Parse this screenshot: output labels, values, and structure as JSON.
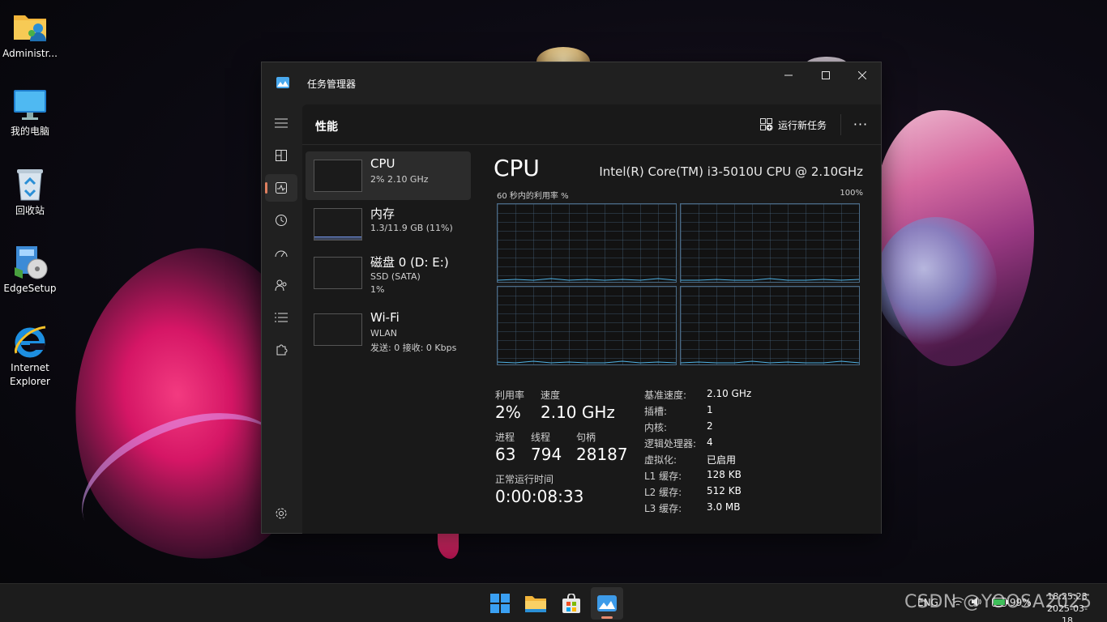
{
  "desktop": {
    "icons": [
      {
        "label": "Administr...",
        "icon": "user-folder-icon"
      },
      {
        "label": "我的电脑",
        "icon": "monitor-icon"
      },
      {
        "label": "回收站",
        "icon": "recycle-bin-icon"
      },
      {
        "label": "EdgeSetup",
        "icon": "installer-icon"
      },
      {
        "label": "Internet\nExplorer",
        "icon": "internet-explorer-icon"
      }
    ]
  },
  "window": {
    "title": "任务管理器"
  },
  "nav": {
    "icons": [
      "hamburger-icon",
      "processes-icon",
      "performance-icon",
      "app-history-icon",
      "startup-icon",
      "users-icon",
      "details-icon",
      "services-icon",
      "settings-icon"
    ],
    "active": "performance"
  },
  "header": {
    "title": "性能",
    "run_task": "运行新任务",
    "more": "···"
  },
  "devices": [
    {
      "name": "CPU",
      "sub": "2% 2.10 GHz",
      "sub2": ""
    },
    {
      "name": "内存",
      "sub": "1.3/11.9 GB (11%)",
      "sub2": ""
    },
    {
      "name": "磁盘 0 (D: E:)",
      "sub": "SSD (SATA)",
      "sub2": "1%"
    },
    {
      "name": "Wi-Fi",
      "sub": "WLAN",
      "sub2": "发送: 0 接收: 0 Kbps"
    }
  ],
  "detail": {
    "title": "CPU",
    "model": "Intel(R) Core(TM) i3-5010U CPU @ 2.10GHz",
    "graph_label": "60 秒内的利用率 %",
    "graph_max": "100%",
    "utilization_label": "利用率",
    "utilization": "2%",
    "speed_label": "速度",
    "speed": "2.10 GHz",
    "processes_label": "进程",
    "processes": "63",
    "threads_label": "线程",
    "threads": "794",
    "handles_label": "句柄",
    "handles": "28187",
    "uptime_label": "正常运行时间",
    "uptime": "0:00:08:33",
    "specs": [
      {
        "k": "基准速度:",
        "v": "2.10 GHz"
      },
      {
        "k": "插槽:",
        "v": "1"
      },
      {
        "k": "内核:",
        "v": "2"
      },
      {
        "k": "逻辑处理器:",
        "v": "4"
      },
      {
        "k": "虚拟化:",
        "v": "已启用"
      },
      {
        "k": "L1 缓存:",
        "v": "128 KB"
      },
      {
        "k": "L2 缓存:",
        "v": "512 KB"
      },
      {
        "k": "L3 缓存:",
        "v": "3.0 MB"
      }
    ]
  },
  "taskbar": {
    "apps": [
      "windows-start-icon",
      "file-explorer-icon",
      "store-icon",
      "task-manager-icon"
    ],
    "lang": "ENG",
    "battery": "99%",
    "time": "18:25:23",
    "date": "2025-03-18"
  },
  "watermark": "CSDN @YOOSA2025",
  "colors": {
    "accent": "#4fb3e6",
    "window": "#202020",
    "content": "#191919",
    "active_indicator": "#e08060"
  }
}
